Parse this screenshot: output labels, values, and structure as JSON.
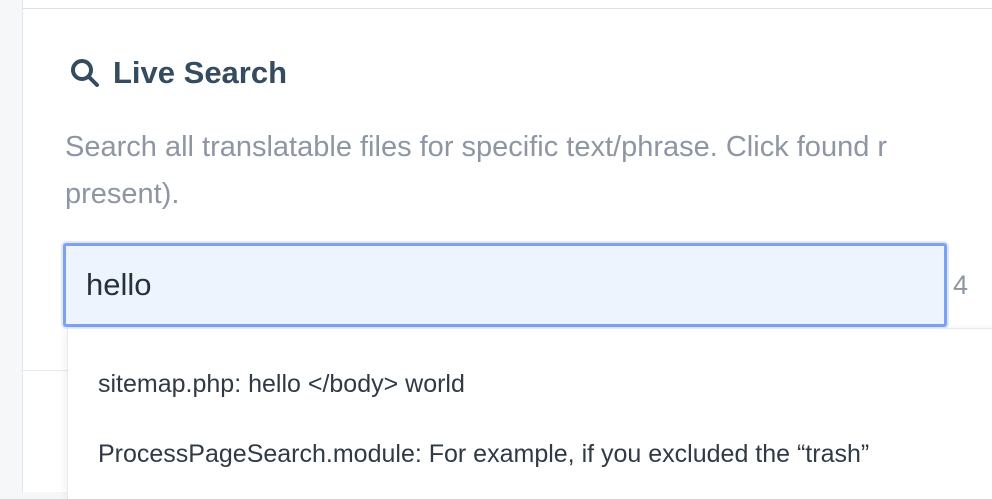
{
  "search_section": {
    "title": "Live Search",
    "icon": "search-icon",
    "description_line1": "Search all translatable files for specific text/phrase. Click found r",
    "description_line2": "present).",
    "input_value": "hello",
    "result_count": "4",
    "results": [
      "sitemap.php: hello </body> world",
      "ProcessPageSearch.module: For example, if you excluded the “trash”"
    ]
  },
  "colors": {
    "title": "#354b60",
    "description": "#8d96a2",
    "input_border": "#7ea2f0",
    "input_background": "#eef4fd"
  }
}
